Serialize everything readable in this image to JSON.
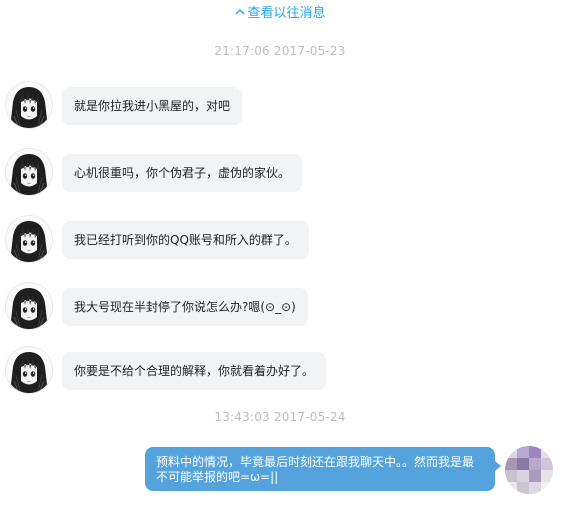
{
  "chat": {
    "history_link": "查看以往消息",
    "icons": {
      "history": "chevron-up-icon",
      "contact_avatar": "anime-girl-avatar",
      "self_avatar": "pixelated-avatar"
    },
    "colors": {
      "link": "#2aa3e6",
      "incoming_bubble": "#f2f3f5",
      "outgoing_bubble": "#54a3dc",
      "timestamp": "#b9bec6"
    },
    "sessions": [
      {
        "timestamp": "21:17:06  2017-05-23",
        "messages": [
          {
            "sender": "contact",
            "text": "就是你拉我进小黑屋的，对吧"
          },
          {
            "sender": "contact",
            "text": "心机很重吗，你个伪君子，虚伪的家伙。"
          },
          {
            "sender": "contact",
            "text": "我已经打听到你的QQ账号和所入的群了。"
          },
          {
            "sender": "contact",
            "text": "我大号现在半封停了你说怎么办?嗯(⊙_⊙)"
          },
          {
            "sender": "contact",
            "text": "你要是不给个合理的解释，你就看着办好了。"
          }
        ]
      },
      {
        "timestamp": "13:43:03  2017-05-24",
        "messages": [
          {
            "sender": "self",
            "text": "预料中的情况，毕竟最后时刻还在跟我聊天中。。然而我是最不可能举报的吧=ω=||"
          }
        ]
      }
    ]
  }
}
